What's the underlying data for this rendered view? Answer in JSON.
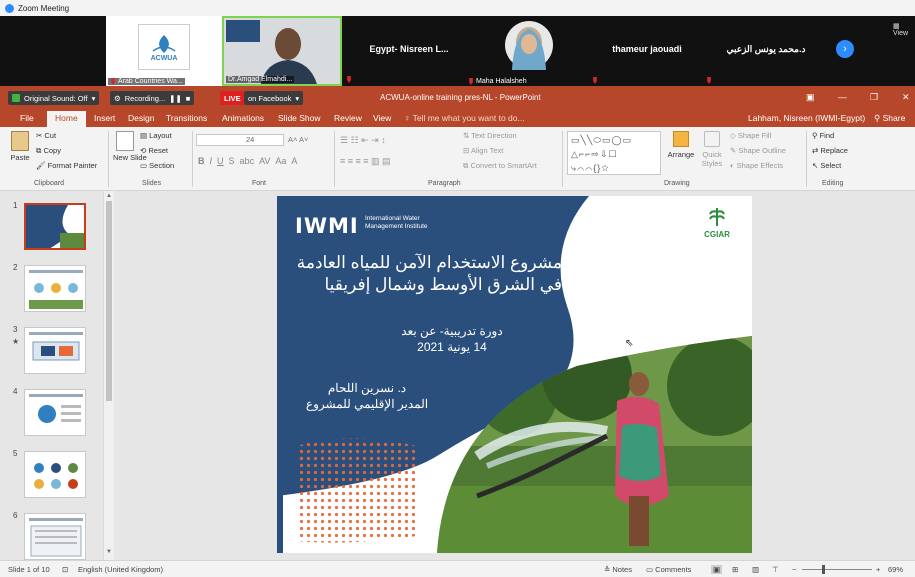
{
  "zoom": {
    "window_title": "Zoom Meeting",
    "participants": [
      {
        "name": "Arab Countries Wa...",
        "logo_text": "ACWUA"
      },
      {
        "name": "Dr.Amgad Elmahdi..."
      },
      {
        "name": "Egypt- Nisreen L..."
      },
      {
        "name": "Maha Halalsheh"
      },
      {
        "name": "thameur jaouadi"
      },
      {
        "name": "د.محمد يونس الزعبي"
      }
    ],
    "view_label": "View"
  },
  "powerpoint": {
    "title": "ACWUA-online training pres-NL - PowerPoint",
    "sound_label": "Original Sound: Off",
    "recording_label": "Recording...",
    "live_label": "LIVE",
    "facebook_label": "on Facebook",
    "tabs": [
      "File",
      "Home",
      "Insert",
      "Design",
      "Transitions",
      "Animations",
      "Slide Show",
      "Review",
      "View"
    ],
    "search_placeholder": "Tell me what you want to do...",
    "user": "Lahham, Nisreen (IWMI-Egypt)",
    "share_label": "Share"
  },
  "ribbon": {
    "clipboard": {
      "paste": "Paste",
      "cut": "Cut",
      "copy": "Copy",
      "format_painter": "Format Painter",
      "label": "Clipboard"
    },
    "slides": {
      "new_slide": "New Slide",
      "layout": "Layout",
      "reset": "Reset",
      "section": "Section",
      "label": "Slides"
    },
    "font": {
      "size": "24",
      "label": "Font"
    },
    "paragraph": {
      "text_direction": "Text Direction",
      "align_text": "Align Text",
      "smartart": "Convert to SmartArt",
      "label": "Paragraph"
    },
    "drawing": {
      "arrange": "Arrange",
      "quick_styles": "Quick Styles",
      "shape_fill": "Shape Fill",
      "shape_outline": "Shape Outline",
      "shape_effects": "Shape Effects",
      "label": "Drawing"
    },
    "editing": {
      "find": "Find",
      "replace": "Replace",
      "select": "Select",
      "label": "Editing"
    }
  },
  "thumbnails": [
    "1",
    "2",
    "3",
    "4",
    "5",
    "6"
  ],
  "slide": {
    "logo": "IWMI",
    "logo_sub": "International Water Management Institute",
    "partner_logo": "CGIAR",
    "title": "مشروع الاستخدام الآمن للمياه العادمة في الشرق الأوسط وشمال إفريقيا",
    "course_line1": "دورة تدريبية- عن بعد",
    "course_line2": "14 يونية 2021",
    "author_line1": "د. نسرين اللحام",
    "author_line2": "المدير الإقليمي للمشروع",
    "colors": {
      "navy": "#2b4f7c",
      "dot_orange": "#e46a3a"
    }
  },
  "status": {
    "slide_info": "Slide 1 of 10",
    "language": "English (United Kingdom)",
    "notes": "Notes",
    "comments": "Comments",
    "zoom": "69%"
  }
}
